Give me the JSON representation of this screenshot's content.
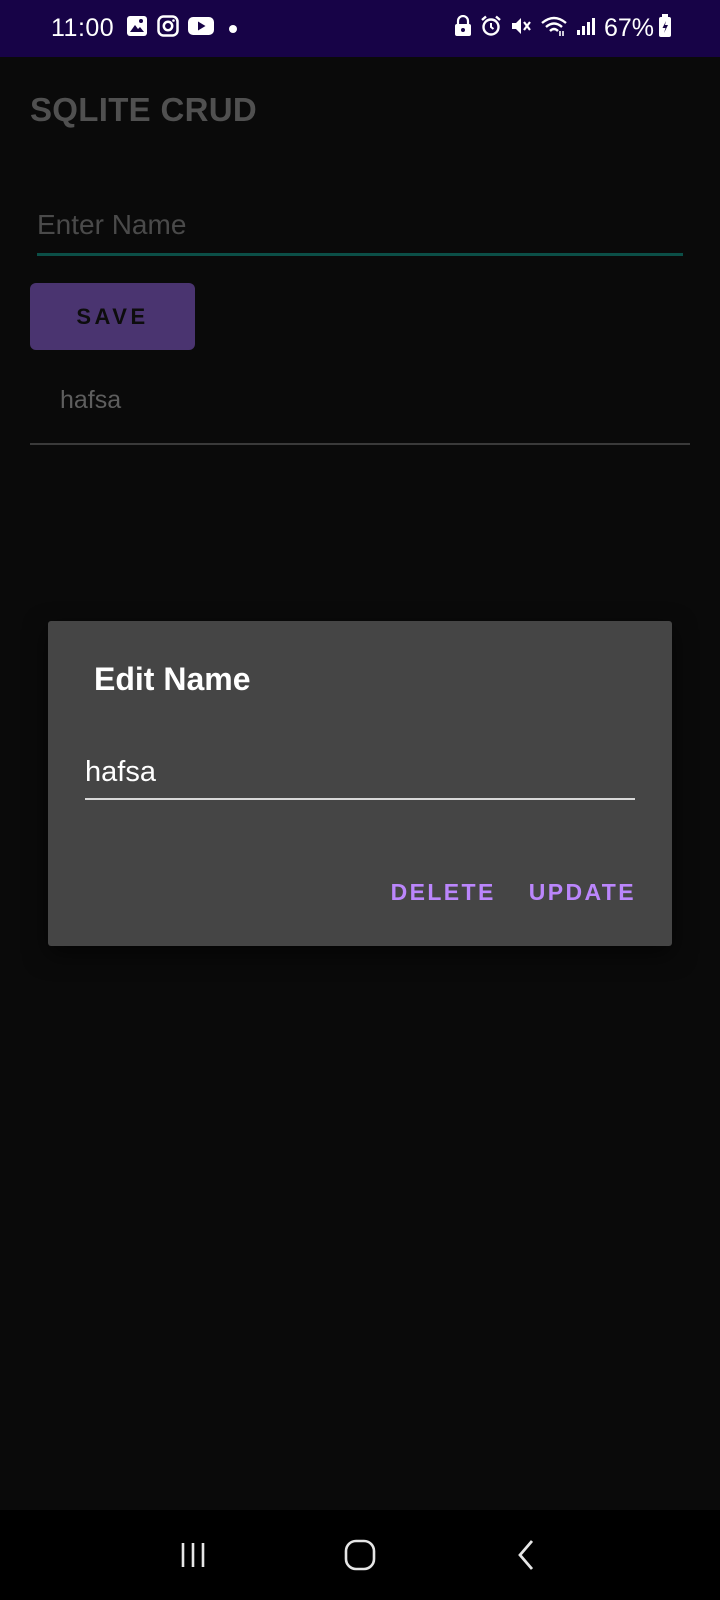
{
  "status_bar": {
    "time": "11:00",
    "battery": "67%",
    "left_icons": [
      "gallery-icon",
      "instagram-icon",
      "youtube-icon",
      "notification-dot-icon"
    ],
    "right_icons": [
      "lock-icon",
      "alarm-icon",
      "mute-icon",
      "wifi-icon",
      "signal-icon",
      "battery-icon"
    ],
    "background_color": "#170347"
  },
  "app": {
    "title": "SQLITE CRUD",
    "input": {
      "placeholder": "Enter Name",
      "value": ""
    },
    "save_label": "SAVE",
    "accent_color": "#4a3470",
    "list_items": [
      {
        "label": "hafsa"
      }
    ]
  },
  "dialog": {
    "title": "Edit Name",
    "input_value": "hafsa",
    "delete_label": "DELETE",
    "update_label": "UPDATE",
    "button_color": "#bb86fc"
  },
  "nav_bar": {
    "buttons": [
      "recent-apps-icon",
      "home-icon",
      "back-icon"
    ]
  }
}
